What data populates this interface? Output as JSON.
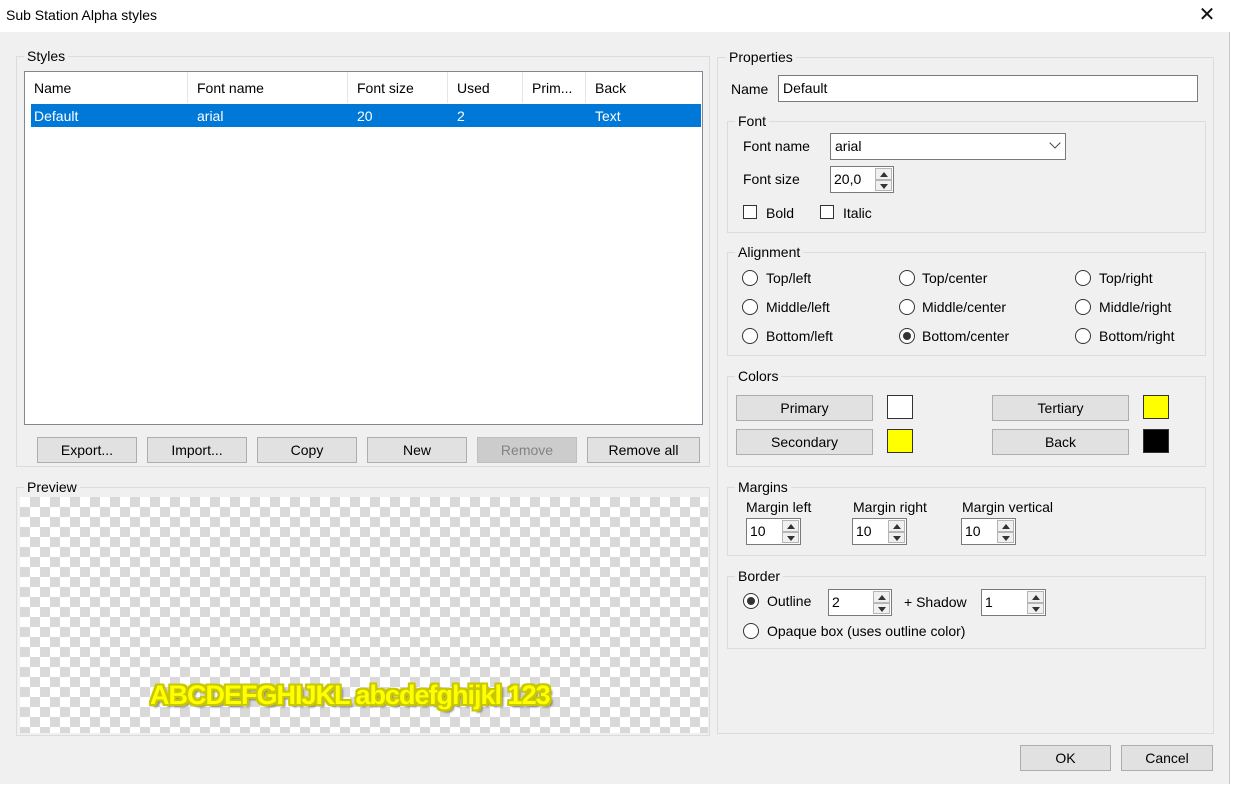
{
  "window": {
    "title": "Sub Station Alpha styles",
    "close_glyph": "✕"
  },
  "styles_group": {
    "label": "Styles",
    "columns": [
      "Name",
      "Font name",
      "Font size",
      "Used",
      "Prim...",
      "Back"
    ],
    "rows": [
      {
        "name": "Default",
        "font_name": "arial",
        "font_size": "20",
        "used": "2",
        "primary": "",
        "back": "Text"
      }
    ],
    "buttons": {
      "export": "Export...",
      "import": "Import...",
      "copy": "Copy",
      "new": "New",
      "remove": "Remove",
      "remove_all": "Remove all"
    }
  },
  "preview": {
    "label": "Preview",
    "sample_text": "ABCDEFGHIJKL abcdefghijkl 123"
  },
  "properties": {
    "label": "Properties",
    "name_label": "Name",
    "name_value": "Default",
    "font": {
      "label": "Font",
      "font_name_label": "Font name",
      "font_name_value": "arial",
      "font_size_label": "Font size",
      "font_size_value": "20,0",
      "bold_label": "Bold",
      "italic_label": "Italic",
      "bold": false,
      "italic": false
    },
    "alignment": {
      "label": "Alignment",
      "options": [
        "Top/left",
        "Top/center",
        "Top/right",
        "Middle/left",
        "Middle/center",
        "Middle/right",
        "Bottom/left",
        "Bottom/center",
        "Bottom/right"
      ],
      "selected": "Bottom/center"
    },
    "colors": {
      "label": "Colors",
      "primary_label": "Primary",
      "secondary_label": "Secondary",
      "tertiary_label": "Tertiary",
      "back_label": "Back",
      "primary_color": "#ffffff",
      "secondary_color": "#ffff00",
      "tertiary_color": "#ffff00",
      "back_color": "#000000"
    },
    "margins": {
      "label": "Margins",
      "left_label": "Margin left",
      "right_label": "Margin right",
      "vertical_label": "Margin vertical",
      "left_value": "10",
      "right_value": "10",
      "vertical_value": "10"
    },
    "border": {
      "label": "Border",
      "outline_label": "Outline",
      "outline_value": "2",
      "shadow_label": "+ Shadow",
      "shadow_value": "1",
      "opaque_label": "Opaque box (uses outline color)",
      "selected": "Outline"
    }
  },
  "dialog_buttons": {
    "ok": "OK",
    "cancel": "Cancel"
  },
  "colors": {
    "selection": "#0078d7",
    "dialog_bg": "#f0f0f0"
  }
}
